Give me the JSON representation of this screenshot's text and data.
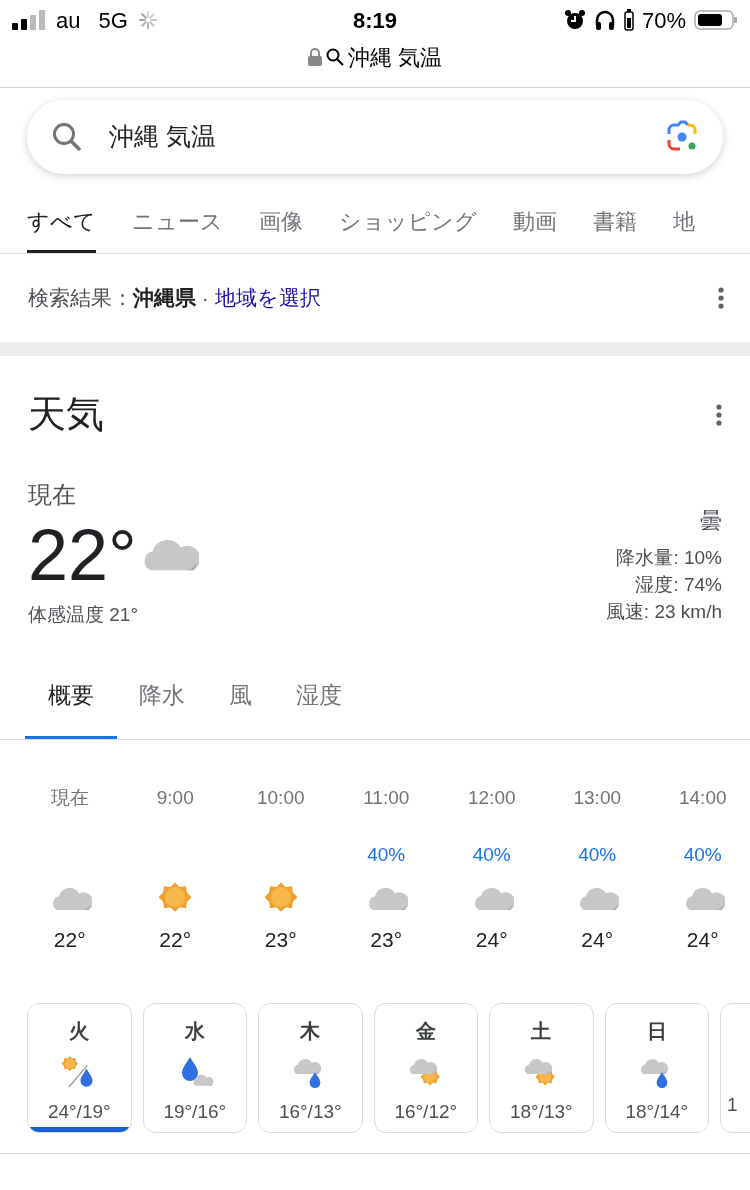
{
  "status_bar": {
    "carrier": "au",
    "network": "5G",
    "time": "8:19",
    "battery": "70%"
  },
  "address_bar": {
    "text": "沖縄 気温"
  },
  "search": {
    "value": "沖縄 気温"
  },
  "tabs": [
    {
      "label": "すべて",
      "selected": true
    },
    {
      "label": "ニュース",
      "selected": false
    },
    {
      "label": "画像",
      "selected": false
    },
    {
      "label": "ショッピング",
      "selected": false
    },
    {
      "label": "動画",
      "selected": false
    },
    {
      "label": "書籍",
      "selected": false
    },
    {
      "label": "地",
      "selected": false
    }
  ],
  "location": {
    "text": "検索結果：**沖縄県** ·",
    "link": "地域を選択"
  },
  "weather": {
    "title": "天気",
    "now_label": "現在",
    "temperature": "22°",
    "feels_like": "体感温度 21°",
    "condition": "曇",
    "details": [
      "降水量: 10%",
      "湿度: 74%",
      "風速: 23 km/h"
    ],
    "subtabs": [
      {
        "label": "概要",
        "selected": true
      },
      {
        "label": "降水",
        "selected": false
      },
      {
        "label": "風",
        "selected": false
      },
      {
        "label": "湿度",
        "selected": false
      }
    ],
    "hourly": [
      {
        "time": "現在",
        "kind": "cloudy",
        "temp": "22°"
      },
      {
        "time": "9:00",
        "kind": "sunny",
        "temp": "22°"
      },
      {
        "time": "10:00",
        "kind": "sunny",
        "temp": "23°"
      },
      {
        "time": "11:00",
        "precip": "40%",
        "kind": "cloudy",
        "temp": "23°"
      },
      {
        "time": "12:00",
        "precip": "40%",
        "kind": "cloudy",
        "temp": "24°"
      },
      {
        "time": "13:00",
        "precip": "40%",
        "kind": "cloudy",
        "temp": "24°"
      },
      {
        "time": "14:00",
        "precip": "40%",
        "kind": "cloudy",
        "temp": "24°"
      }
    ],
    "daily": [
      {
        "day": "火",
        "kind": "sun_rain",
        "temps": "24°/19°",
        "selected": true
      },
      {
        "day": "水",
        "kind": "rain_cloud",
        "temps": "19°/16°",
        "selected": false
      },
      {
        "day": "木",
        "kind": "cloud_rain",
        "temps": "16°/13°",
        "selected": false
      },
      {
        "day": "金",
        "kind": "cloud_sun",
        "temps": "16°/12°",
        "selected": false
      },
      {
        "day": "土",
        "kind": "cloud_sun",
        "temps": "18°/13°",
        "selected": false
      },
      {
        "day": "日",
        "kind": "cloud_rain",
        "temps": "18°/14°",
        "selected": false
      },
      {
        "temps": "1",
        "kind": "partial",
        "selected": false
      }
    ]
  }
}
